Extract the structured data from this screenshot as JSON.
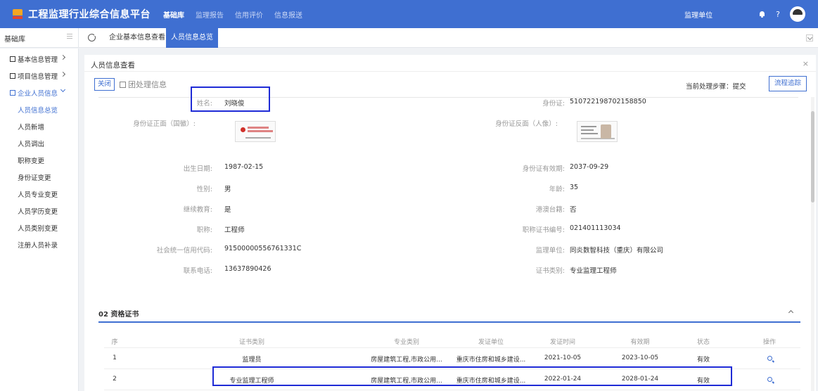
{
  "app": {
    "title": "工程监理行业综合信息平台",
    "nav": [
      "基础库",
      "监理报告",
      "信用评价",
      "信息报送"
    ],
    "active_nav": "基础库",
    "unit_label": "监理单位",
    "help": "?"
  },
  "subbar": {
    "title": "基础库",
    "tabs": [
      "企业基本信息查看",
      "人员信息总览"
    ]
  },
  "sidebar": {
    "groups": [
      {
        "label": "基本信息管理"
      },
      {
        "label": "项目信息管理"
      },
      {
        "label": "企业人员信息"
      }
    ],
    "items": [
      "人员信息总览",
      "人员新增",
      "人员调出",
      "职称变更",
      "身份证变更",
      "人员专业变更",
      "人员学历变更",
      "人员类别变更",
      "注册人员补录"
    ]
  },
  "panel": {
    "title": "人员信息查看",
    "close_btn": "关闭",
    "todo": "团处理信息",
    "step": "当前处理步骤：提交",
    "flow_btn": "流程追踪"
  },
  "person": {
    "name_label": "姓名:",
    "name": "刘晓俊",
    "id_label": "身份证:",
    "id": "510722198702158850",
    "id_front_label": "身份证正面（国徽）:",
    "id_back_label": "身份证反面（人像）:",
    "birth_label": "出生日期:",
    "birth": "1987-02-15",
    "id_valid_label": "身份证有效期:",
    "id_valid": "2037-09-29",
    "gender_label": "性别:",
    "gender": "男",
    "age_label": "年龄:",
    "age": "35",
    "edu_label": "继续教育:",
    "edu": "是",
    "hk_label": "港澳台籍:",
    "hk": "否",
    "title_label": "职称:",
    "title_val": "工程师",
    "title_no_label": "职称证书编号:",
    "title_no": "021401113034",
    "credit_label": "社会统一信用代码:",
    "credit": "91500000556761331C",
    "unit_label": "监理单位:",
    "unit": "同炎数智科技（重庆）有限公司",
    "phone_label": "联系电话:",
    "phone": "13637890426",
    "cert_type_label": "证书类别:",
    "cert_type": "专业监理工程师"
  },
  "certs": {
    "section_title": "02  资格证书",
    "headers": [
      "序",
      "证书类别",
      "专业类别",
      "发证单位",
      "发证时间",
      "有效期",
      "状态",
      "操作"
    ],
    "rows": [
      [
        "1",
        "监理员",
        "房屋建筑工程,市政公用...",
        "重庆市住房和城乡建设...",
        "2021-10-05",
        "2023-10-05",
        "有效"
      ],
      [
        "2",
        "专业监理工程师",
        "房屋建筑工程,市政公用...",
        "重庆市住房和城乡建设...",
        "2022-01-24",
        "2028-01-24",
        "有效"
      ]
    ]
  },
  "colors": {
    "primary": "#3f6fd1",
    "highlight": "#1f2bd6"
  }
}
